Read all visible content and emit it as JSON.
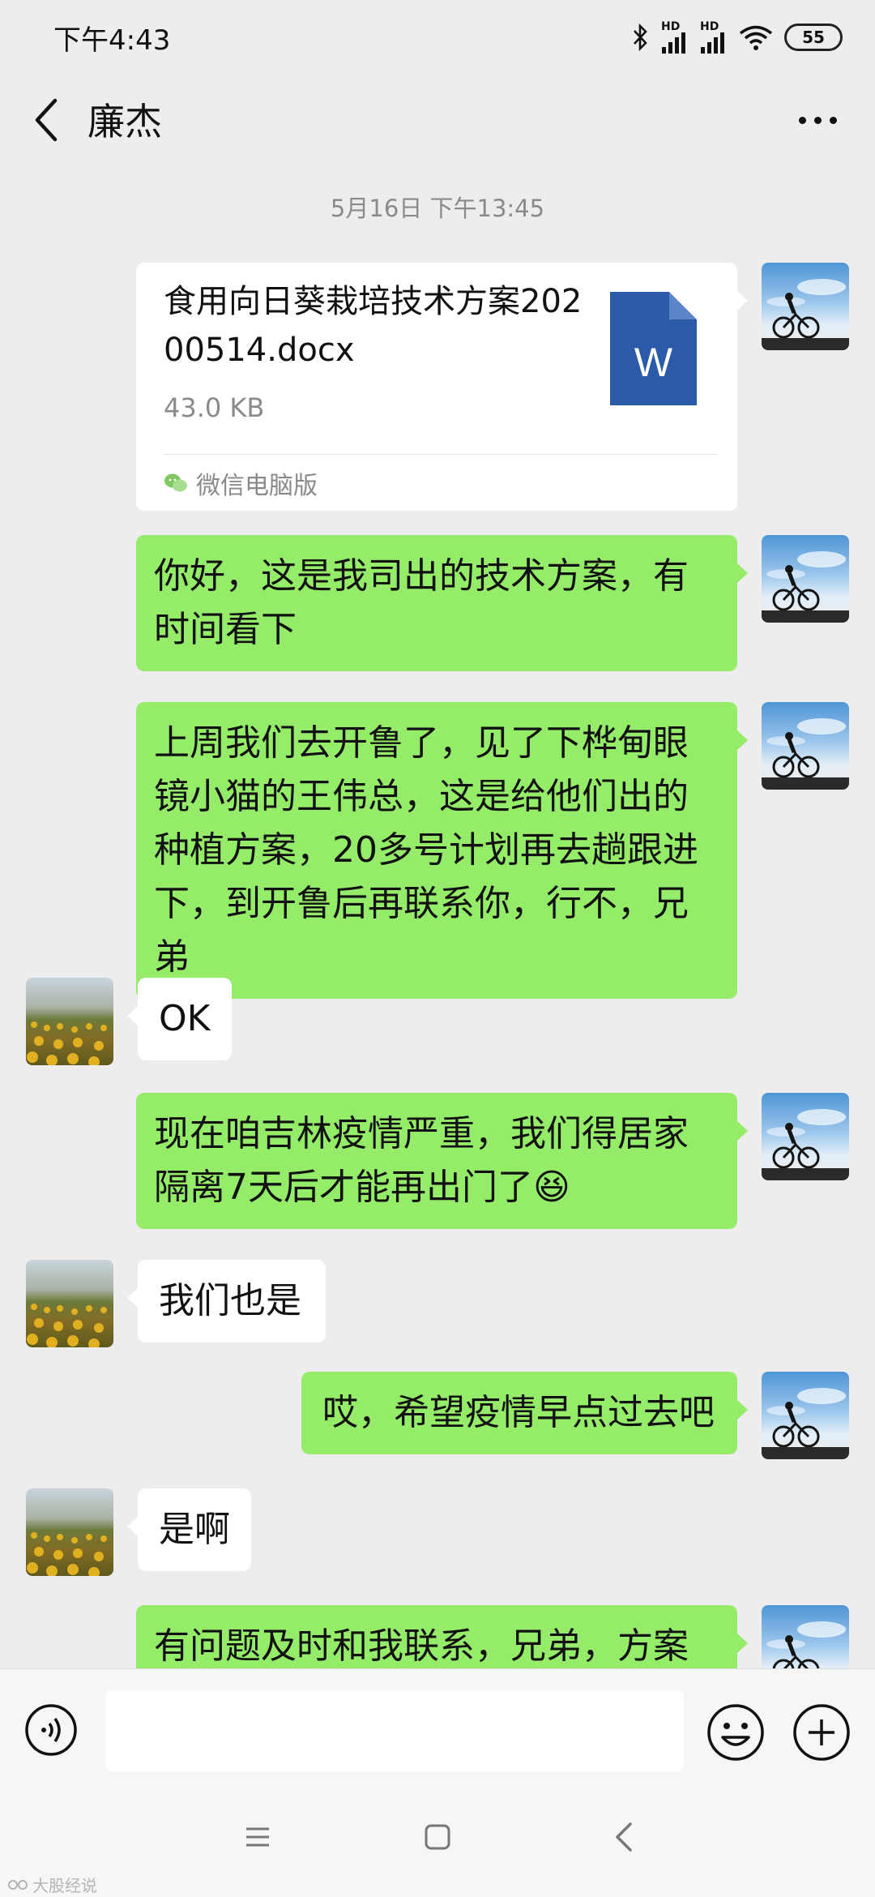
{
  "status_bar": {
    "time": "下午4:43",
    "hd1": "HD",
    "hd2": "HD",
    "battery": "55"
  },
  "header": {
    "title": "廉杰"
  },
  "chat": {
    "timestamp": "5月16日 下午13:45",
    "file": {
      "name": "食用向日葵栽培技术方案20200514.docx",
      "size": "43.0 KB",
      "icon_letter": "W",
      "source": "微信电脑版"
    },
    "messages": [
      {
        "text": "你好，这是我司出的技术方案，有时间看下"
      },
      {
        "text": "上周我们去开鲁了，见了下桦甸眼镜小猫的王伟总，这是给他们出的种植方案，20多号计划再去趟跟进下，到开鲁后再联系你，行不，兄弟"
      },
      {
        "text": "OK"
      },
      {
        "text": "现在咱吉林疫情严重，我们得居家隔离7天后才能再出门了😆"
      },
      {
        "text": "我们也是"
      },
      {
        "text": "哎，希望疫情早点过去吧"
      },
      {
        "text": "是啊"
      },
      {
        "text": "有问题及时和我联系，兄弟，方案中"
      }
    ]
  },
  "input_bar": {
    "placeholder": ""
  },
  "watermark": {
    "text": "大股经说"
  },
  "colors": {
    "background": "#ededed",
    "sent_bubble": "#95ec69",
    "received_bubble": "#ffffff",
    "word_blue": "#2b5aa8"
  }
}
